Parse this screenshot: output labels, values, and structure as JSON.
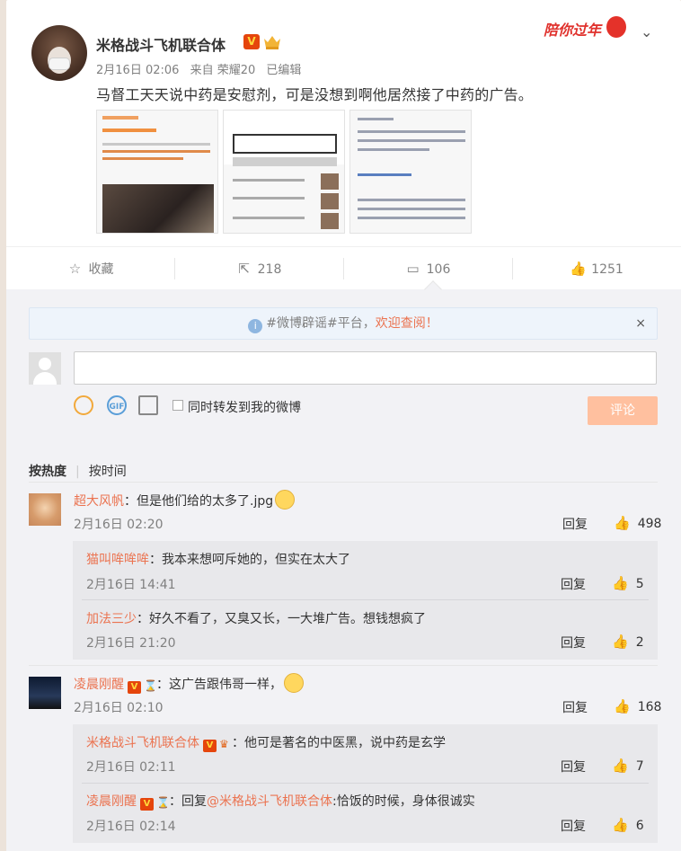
{
  "post": {
    "author": "米格战斗飞机联合体",
    "v_badge": "V",
    "time": "2月16日 02:06",
    "source": "来自 荣耀20",
    "edited": "已编辑",
    "festive_label": "陪你过年",
    "text": "马督工天天说中药是安慰剂，可是没想到啊他居然接了中药的广告。"
  },
  "actions": {
    "favorite": "收藏",
    "repost": "218",
    "comment": "106",
    "like": "1251"
  },
  "notice": {
    "prefix": "#微博辟谣#平台，",
    "highlight": "欢迎查阅！",
    "close": "×"
  },
  "composer": {
    "gif": "GIF",
    "repost_label": "同时转发到我的微博",
    "submit": "评论"
  },
  "sort": {
    "hot": "按热度",
    "time": "按时间"
  },
  "comments": [
    {
      "name": "超大风帆",
      "text": "：但是他们给的太多了.jpg",
      "time": "2月16日 02:20",
      "reply": "回复",
      "likes": "498",
      "replies": [
        {
          "name": "猫叫哞哞哞",
          "text": "：我本来想呵斥她的，但实在太大了",
          "time": "2月16日 14:41",
          "reply": "回复",
          "likes": "5"
        },
        {
          "name": "加法三少",
          "text": "：好久不看了，又臭又长，一大堆广告。想钱想疯了",
          "time": "2月16日 21:20",
          "reply": "回复",
          "likes": "2"
        }
      ]
    },
    {
      "name": "凌晨刚醒",
      "text": "：这广告跟伟哥一样，",
      "time": "2月16日 02:10",
      "reply": "回复",
      "likes": "168",
      "replies": [
        {
          "name": "米格战斗飞机联合体",
          "text": "：他可是著名的中医黑，说中药是玄学",
          "time": "2月16日 02:11",
          "reply": "回复",
          "likes": "7"
        },
        {
          "name": "凌晨刚醒",
          "text_prefix": "：回复",
          "mention": "@米格战斗飞机联合体",
          "text": ":恰饭的时候，身体很诚实",
          "time": "2月16日 02:14",
          "reply": "回复",
          "likes": "6"
        }
      ]
    }
  ],
  "colors": {
    "accent": "#eb7350",
    "link": "#eb7350",
    "submit_disabled": "#ffc09f",
    "comment_bg": "#f2f2f5"
  }
}
